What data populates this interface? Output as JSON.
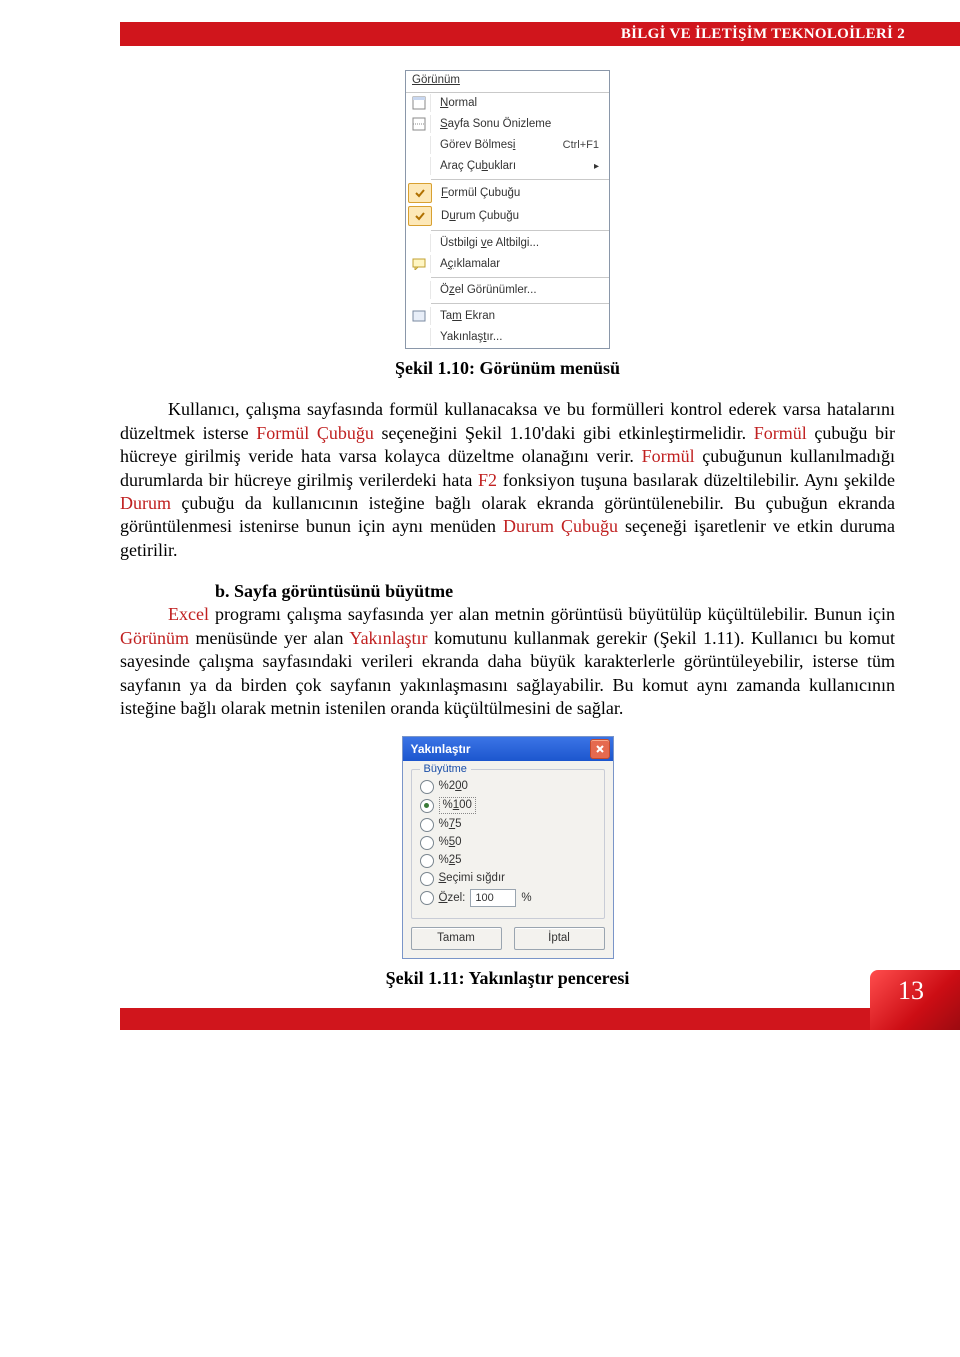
{
  "header_title": "BİLGİ VE İLETİŞİM TEKNOLOİLERİ 2",
  "menu": {
    "title_underline": "G",
    "title_rest": "örünüm",
    "items": [
      {
        "icon": "doc-norm",
        "ul": "N",
        "rest": "ormal"
      },
      {
        "icon": "doc-page",
        "ul": "S",
        "rest": "ayfa Sonu Önizleme"
      },
      {
        "icon": "",
        "lbl": "Görev Bölmes",
        "ul": "i",
        "rest": "",
        "shortcut": "Ctrl+F1"
      },
      {
        "icon": "",
        "lbl": "Araç Çu",
        "ul": "b",
        "rest": "ukları",
        "arrow": true
      },
      {
        "icon": "check",
        "ul": "F",
        "rest": "ormül Çubuğu"
      },
      {
        "icon": "check",
        "ul": "",
        "lbl": "D",
        "ul2": "u",
        "rest": "rum Çubuğu"
      },
      {
        "icon": "",
        "lbl": "Üstbilgi ",
        "ul": "v",
        "rest": "e Altbilgi..."
      },
      {
        "icon": "comment",
        "lbl": "A",
        "ul": "ç",
        "rest": "ıklamalar"
      },
      {
        "icon": "",
        "lbl": "Ö",
        "ul": "z",
        "rest": "el Görünümler..."
      },
      {
        "icon": "fullscr",
        "lbl": "Ta",
        "ul": "m",
        "rest": " Ekran"
      },
      {
        "icon": "",
        "lbl": "Yakınlaş",
        "ul": "t",
        "rest": "ır..."
      }
    ]
  },
  "caption1": "Şekil 1.10: Görünüm menüsü",
  "para1_a": "Kullanıcı, çalışma sayfasında formül kullanacaksa ve bu formülleri kontrol ederek varsa hatalarını düzeltmek isterse ",
  "para1_b": "Formül Çubuğu",
  "para1_c": " seçeneğini Şekil 1.10'daki gibi etkinleştirmelidir. ",
  "para1_d": "Formül",
  "para1_e": " çubuğu bir hücreye girilmiş veride hata varsa kolayca düzeltme olanağını verir. ",
  "para1_f": "Formül",
  "para1_g": " çubuğunun kullanılmadığı durumlarda bir hücreye girilmiş verilerdeki hata ",
  "para1_h": "F2",
  "para1_i": " fonksiyon tuşuna basılarak düzeltilebilir. Aynı şekilde ",
  "para1_j": "Durum",
  "para1_k": " çubuğu da kullanıcının isteğine bağlı olarak ekranda görüntülenebilir. Bu çubuğun ekranda görüntülenmesi istenirse bunun için aynı menüden ",
  "para1_l": "Durum Çubuğu",
  "para1_m": " seçeneği işaretlenir ve etkin duruma getirilir.",
  "subheading": "b. Sayfa görüntüsünü büyütme",
  "para2_a": "Excel",
  "para2_b": " programı çalışma sayfasında yer alan metnin görüntüsü büyütülüp küçültülebilir. Bunun için ",
  "para2_c": "Görünüm",
  "para2_d": " menüsünde yer alan ",
  "para2_e": "Yakınlaştır",
  "para2_f": " komutunu kullanmak gerekir (Şekil 1.11). Kullanıcı bu komut sayesinde çalışma sayfasındaki verileri ekranda daha büyük karakterlerle görüntüleyebilir, isterse tüm sayfanın ya da birden çok sayfanın yakınlaşmasını sağlayabilir. Bu komut aynı zamanda kullanıcının isteğine bağlı olarak metnin istenilen oranda küçültülmesini de sağlar.",
  "zoom": {
    "title": "Yakınlaştır",
    "group": "Büyütme",
    "opt200_a": "%2",
    "opt200_b": "0",
    "opt200_c": "0",
    "opt100_a": "%",
    "opt100_b": "1",
    "opt100_c": "00",
    "opt75_a": "%",
    "opt75_b": "7",
    "opt75_c": "5",
    "opt50_a": "%",
    "opt50_b": "5",
    "opt50_c": "0",
    "opt25_a": "%",
    "opt25_b": "2",
    "opt25_c": "5",
    "optfit_a": "S",
    "optfit_b": "eçimi sığdır",
    "optozel_a": "Ö",
    "optozel_b": "zel:",
    "ozel_val": "100",
    "ozel_unit": "%",
    "btn_ok": "Tamam",
    "btn_cancel": "İptal"
  },
  "caption2": "Şekil 1.11: Yakınlaştır penceresi",
  "page_number": "13"
}
